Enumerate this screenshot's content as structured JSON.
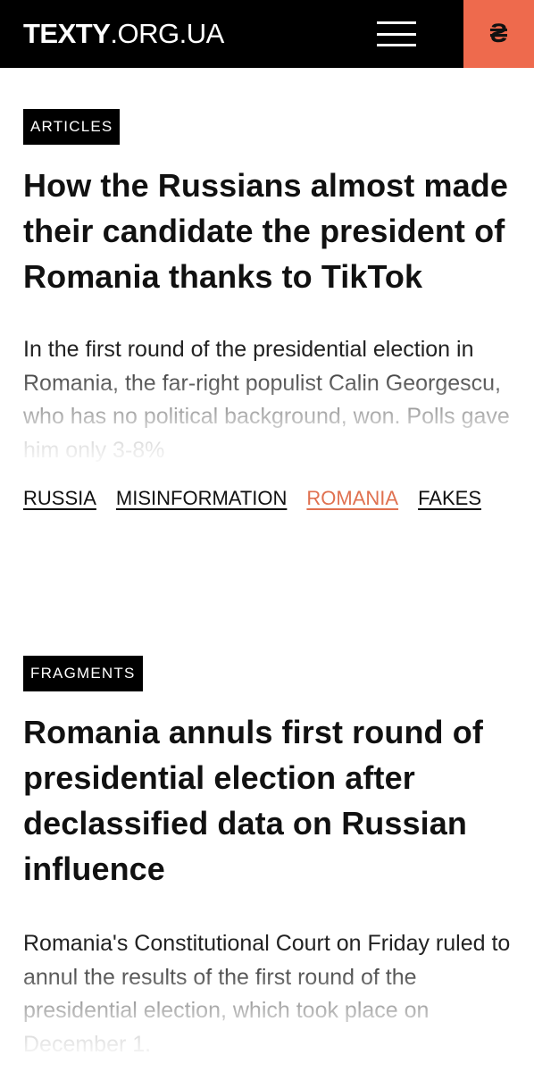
{
  "header": {
    "logo_bold": "TEXTY",
    "logo_thin": ".ORG.UA",
    "donate_symbol": "₴"
  },
  "articles": [
    {
      "category": "ARTICLES",
      "title": "How the Russians almost made their candidate the president of Romania thanks to TikTok",
      "excerpt": "In the first round of the presidential election in Romania, the far-right populist Calin Georgescu, who has no political background, won. Polls gave him only 3-8%",
      "tags": [
        "RUSSIA",
        "MISINFORMATION",
        "ROMANIA",
        "FAKES"
      ],
      "active_tag": "ROMANIA"
    },
    {
      "category": "FRAGMENTS",
      "title": "Romania annuls first round of presidential election after declassified data on Russian influence",
      "excerpt": "Romania's Constitutional Court on Friday ruled to annul the results of the first round of the presidential election, which took place on December 1."
    }
  ],
  "colors": {
    "header_bg": "#000000",
    "accent": "#ee6a4d",
    "active_tag": "#e07150"
  }
}
